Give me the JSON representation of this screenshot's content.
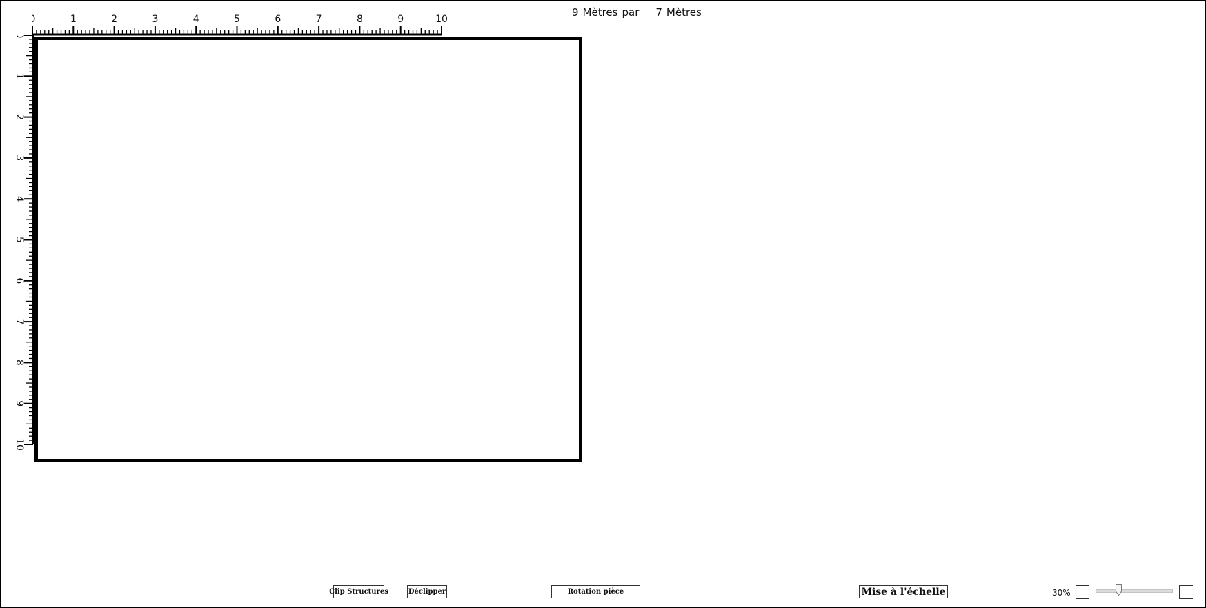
{
  "header": {
    "width_value": "9",
    "width_unit": "Mètres",
    "separator": "par",
    "height_value": "7",
    "height_unit": "Mètres"
  },
  "ruler": {
    "horizontal_labels": [
      "0",
      "1",
      "2",
      "3",
      "4",
      "5",
      "6",
      "7",
      "8",
      "9",
      "10"
    ],
    "vertical_labels": [
      "0",
      "1",
      "2",
      "3",
      "4",
      "5",
      "6",
      "7",
      "8",
      "9",
      "10"
    ]
  },
  "toolbar": {
    "clip_label": "Clip Structures",
    "declip_label": "Déclipper",
    "rotate_label": "Rotation pièce",
    "scale_label": "Mise à l'échelle"
  },
  "zoom": {
    "label": "30%",
    "level_fraction": 0.3
  },
  "colors": {
    "outline": "#000000",
    "slider_track": "#dcdcdc",
    "background": "#ffffff"
  }
}
